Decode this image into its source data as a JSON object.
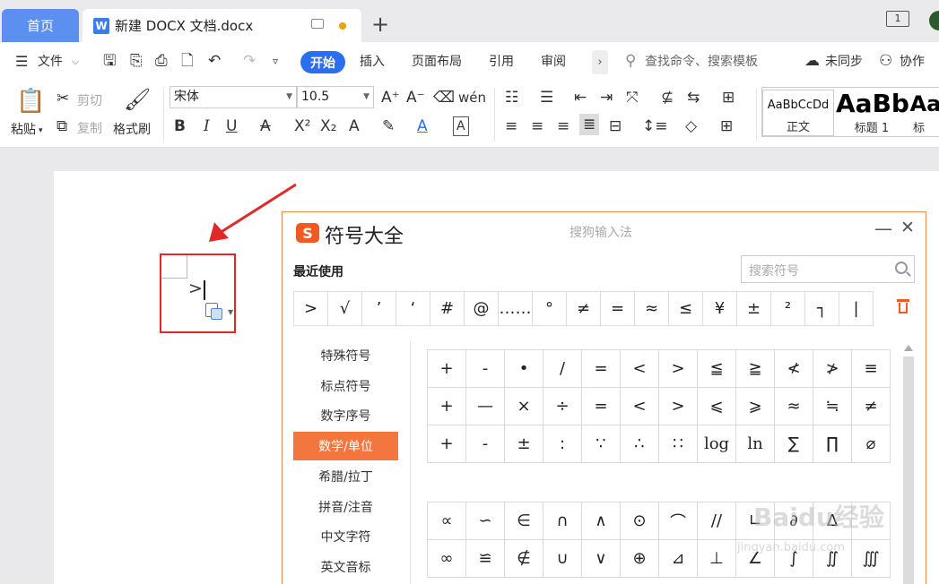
{
  "tabbar": {
    "home_tab": "首页",
    "doc_tab": "新建 DOCX 文档.docx",
    "doc_icon": "W",
    "window_count": "1"
  },
  "menubar": {
    "file": "文件",
    "tabs": [
      "开始",
      "插入",
      "页面布局",
      "引用",
      "审阅"
    ],
    "more_chev": "›",
    "search_cmd": "查找命令、搜索模板",
    "sync": "未同步",
    "collab": "协作"
  },
  "ribbon": {
    "paste": "粘贴",
    "cut": "剪切",
    "copy": "复制",
    "format_painter": "格式刷",
    "font_name": "宋体",
    "font_size": "10.5",
    "styles": [
      {
        "preview": "AaBbCcDd",
        "name": "正文"
      },
      {
        "preview": "AaBb",
        "name": "标题 1"
      },
      {
        "preview": "Aa",
        "name": "标"
      }
    ]
  },
  "document": {
    "typed_text": ">"
  },
  "symbol_panel": {
    "logo": "S",
    "title": "符号大全",
    "subtitle": "搜狗输入法",
    "minimize": "—",
    "close": "✕",
    "recent_label": "最近使用",
    "search_placeholder": "搜索符号",
    "recent": [
      ">",
      "√",
      "’",
      "‘",
      "#",
      "@",
      "……",
      "°",
      "≠",
      "=",
      "≈",
      "≤",
      "¥",
      "±",
      "²",
      "┐",
      "|"
    ],
    "categories": [
      "特殊符号",
      "标点符号",
      "数字序号",
      "数学/单位",
      "希腊/拉丁",
      "拼音/注音",
      "中文字符",
      "英文音标"
    ],
    "active_category": "数学/单位",
    "grid1": [
      "+",
      "-",
      "•",
      "/",
      "=",
      "<",
      ">",
      "≦",
      "≧",
      "≮",
      "≯",
      "≡",
      "+",
      "—",
      "×",
      "÷",
      "=",
      "<",
      ">",
      "⩽",
      "⩾",
      "≈",
      "≒",
      "≠",
      "+",
      "-",
      "±",
      ":",
      "∵",
      "∴",
      "∷",
      "log",
      "ln",
      "∑",
      "∏",
      "⌀"
    ],
    "grid2": [
      "∝",
      "∽",
      "∈",
      "∩",
      "∧",
      "⊙",
      "⌒",
      "//",
      "∟",
      "∂",
      "∆",
      "",
      "∞",
      "≌",
      "∉",
      "∪",
      "∨",
      "⊕",
      "⊿",
      "⊥",
      "∠",
      "∫",
      "∬",
      "∭"
    ]
  },
  "watermark": {
    "brand": "Baidu经验",
    "url": "jingyan.baidu.com"
  },
  "colors": {
    "accent_blue": "#2a6ff0",
    "home_tab": "#5b8ff0",
    "panel_orange": "#f2763e",
    "annotation_red": "#e02a2a"
  }
}
